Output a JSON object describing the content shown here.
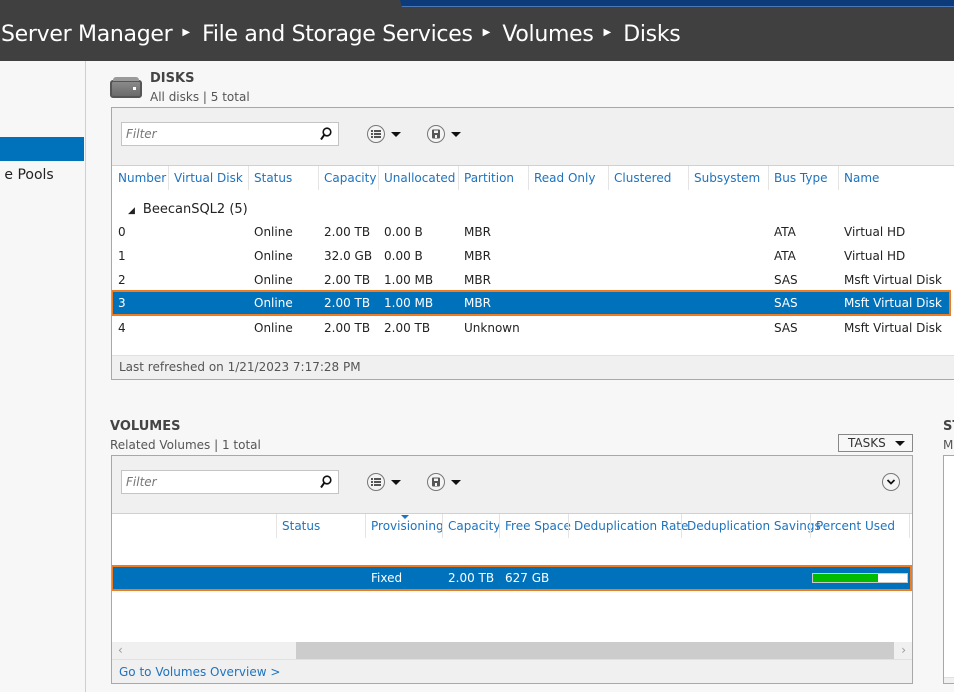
{
  "window": {
    "breadcrumb": [
      "Server Manager",
      "File and Storage Services",
      "Volumes",
      "Disks"
    ]
  },
  "sidebar": {
    "items": [
      {
        "label": "",
        "selected": true
      },
      {
        "label": "Storage Pools",
        "visible_label": "e Pools",
        "selected": false
      }
    ]
  },
  "disks": {
    "title": "DISKS",
    "subtitle": "All disks | 5 total",
    "filter_placeholder": "Filter",
    "columns": [
      "Number",
      "Virtual Disk",
      "Status",
      "Capacity",
      "Unallocated",
      "Partition",
      "Read Only",
      "Clustered",
      "Subsystem",
      "Bus Type",
      "Name"
    ],
    "group": {
      "label": "BeecanSQL2 (5)",
      "expanded": true
    },
    "rows": [
      {
        "number": "0",
        "virtual_disk": "",
        "status": "Online",
        "capacity": "2.00 TB",
        "unallocated": "0.00 B",
        "partition": "MBR",
        "read_only": "",
        "clustered": "",
        "subsystem": "",
        "bus_type": "ATA",
        "name": "Virtual HD",
        "selected": false
      },
      {
        "number": "1",
        "virtual_disk": "",
        "status": "Online",
        "capacity": "32.0 GB",
        "unallocated": "0.00 B",
        "partition": "MBR",
        "read_only": "",
        "clustered": "",
        "subsystem": "",
        "bus_type": "ATA",
        "name": "Virtual HD",
        "selected": false
      },
      {
        "number": "2",
        "virtual_disk": "",
        "status": "Online",
        "capacity": "2.00 TB",
        "unallocated": "1.00 MB",
        "partition": "MBR",
        "read_only": "",
        "clustered": "",
        "subsystem": "",
        "bus_type": "SAS",
        "name": "Msft Virtual Disk",
        "selected": false
      },
      {
        "number": "3",
        "virtual_disk": "",
        "status": "Online",
        "capacity": "2.00 TB",
        "unallocated": "1.00 MB",
        "partition": "MBR",
        "read_only": "",
        "clustered": "",
        "subsystem": "",
        "bus_type": "SAS",
        "name": "Msft Virtual Disk",
        "selected": true
      },
      {
        "number": "4",
        "virtual_disk": "",
        "status": "Online",
        "capacity": "2.00 TB",
        "unallocated": "2.00 TB",
        "partition": "Unknown",
        "read_only": "",
        "clustered": "",
        "subsystem": "",
        "bus_type": "SAS",
        "name": "Msft Virtual Disk",
        "selected": false
      }
    ],
    "footer": "Last refreshed on 1/21/2023 7:17:28 PM"
  },
  "volumes": {
    "title": "VOLUMES",
    "subtitle": "Related Volumes | 1 total",
    "tasks_label": "TASKS",
    "filter_placeholder": "Filter",
    "columns": [
      "",
      "Status",
      "Provisioning",
      "Capacity",
      "Free Space",
      "Deduplication Rate",
      "Deduplication Savings",
      "Percent Used"
    ],
    "sorted_column": "Provisioning",
    "rows": [
      {
        "status": "",
        "provisioning": "Fixed",
        "capacity": "2.00 TB",
        "free_space": "627 GB",
        "dedup_rate": "",
        "dedup_savings": "",
        "percent_used": 69,
        "selected": true
      }
    ],
    "footer_link": "Go to Volumes Overview >"
  },
  "storage_panel": {
    "title_visible": "ST",
    "subtitle_visible": "M"
  },
  "colors": {
    "header_bg": "#404040",
    "selection": "#0072bc",
    "highlight_outline": "#f07c22",
    "link": "#1e73be",
    "progress_fill": "#00bb00"
  }
}
